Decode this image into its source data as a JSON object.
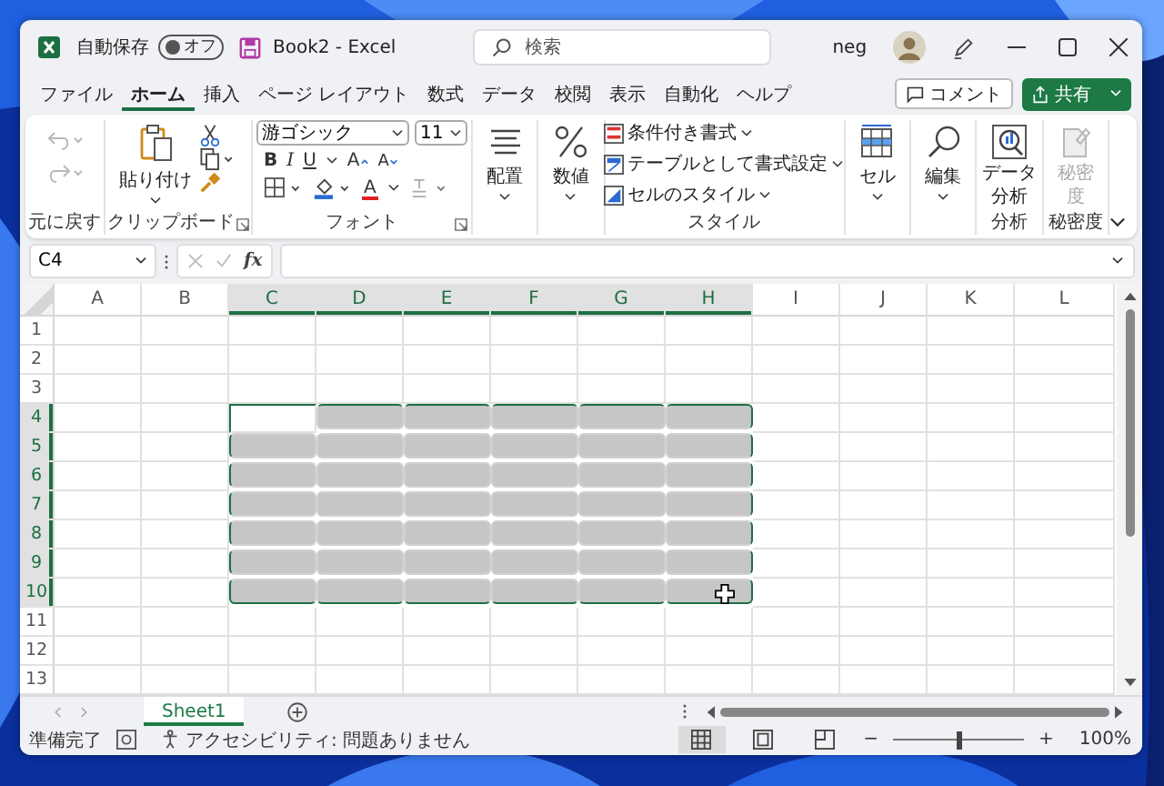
{
  "title_bar": {
    "autosave_label": "自動保存",
    "autosave": {
      "label": "オフ",
      "on": false
    },
    "document_title": "Book2  -  Excel",
    "search": {
      "placeholder": "検索"
    },
    "user_name": "neg"
  },
  "menu_tabs": [
    {
      "label": "ファイル",
      "selected": false
    },
    {
      "label": "ホーム",
      "selected": true
    },
    {
      "label": "挿入",
      "selected": false
    },
    {
      "label": "ページ レイアウト",
      "selected": false
    },
    {
      "label": "数式",
      "selected": false
    },
    {
      "label": "データ",
      "selected": false
    },
    {
      "label": "校閲",
      "selected": false
    },
    {
      "label": "表示",
      "selected": false
    },
    {
      "label": "自動化",
      "selected": false
    },
    {
      "label": "ヘルプ",
      "selected": false
    }
  ],
  "comment_button": "コメント",
  "share_button": "共有",
  "ribbon": {
    "undo": {
      "disabled": true,
      "label": "元に戻す"
    },
    "clipboard": {
      "paste": "貼り付け",
      "label": "クリップボード"
    },
    "font": {
      "name": "游ゴシック",
      "size": "11",
      "bold": "B",
      "italic": "I",
      "underline": "U",
      "grow": "A",
      "shrink": "A",
      "font_color": "A",
      "label": "フォント"
    },
    "alignment": "配置",
    "number": "数値",
    "styles": {
      "items": [
        "条件付き書式",
        "テーブルとして書式設定",
        "セルのスタイル"
      ],
      "label": "スタイル"
    },
    "cells": "セル",
    "editing": "編集",
    "analysis": {
      "button": "データ分析",
      "label": "分析"
    },
    "sensitivity": {
      "button": "秘密度",
      "disabled": true,
      "label": "秘密度"
    }
  },
  "formula_bar": {
    "name_box": "C4",
    "fx": "fx"
  },
  "sheet": {
    "columns": [
      {
        "label": "A",
        "selected": false
      },
      {
        "label": "B",
        "selected": false
      },
      {
        "label": "C",
        "selected": true
      },
      {
        "label": "D",
        "selected": true
      },
      {
        "label": "E",
        "selected": true
      },
      {
        "label": "F",
        "selected": true
      },
      {
        "label": "G",
        "selected": true
      },
      {
        "label": "H",
        "selected": true
      },
      {
        "label": "I",
        "selected": false
      },
      {
        "label": "J",
        "selected": false
      },
      {
        "label": "K",
        "selected": false
      },
      {
        "label": "L",
        "selected": false
      }
    ],
    "rows": [
      {
        "label": "1",
        "selected": false
      },
      {
        "label": "2",
        "selected": false
      },
      {
        "label": "3",
        "selected": false
      },
      {
        "label": "4",
        "selected": true
      },
      {
        "label": "5",
        "selected": true
      },
      {
        "label": "6",
        "selected": true
      },
      {
        "label": "7",
        "selected": true
      },
      {
        "label": "8",
        "selected": true
      },
      {
        "label": "9",
        "selected": true
      },
      {
        "label": "10",
        "selected": true
      },
      {
        "label": "11",
        "selected": false
      },
      {
        "label": "12",
        "selected": false
      },
      {
        "label": "13",
        "selected": false
      }
    ]
  },
  "sheet_tabs": [
    {
      "label": "Sheet1",
      "selected": true
    }
  ],
  "status_bar": {
    "ready": "準備完了",
    "accessibility": "アクセシビリティ: 問題ありません",
    "views": [
      {
        "kind": "normal",
        "selected": true
      },
      {
        "kind": "page_layout",
        "selected": false
      },
      {
        "kind": "page_break",
        "selected": false
      }
    ],
    "zoom_minus": "−",
    "zoom_plus": "+",
    "zoom": {
      "level": 0.5
    },
    "zoom_label": "100%"
  }
}
